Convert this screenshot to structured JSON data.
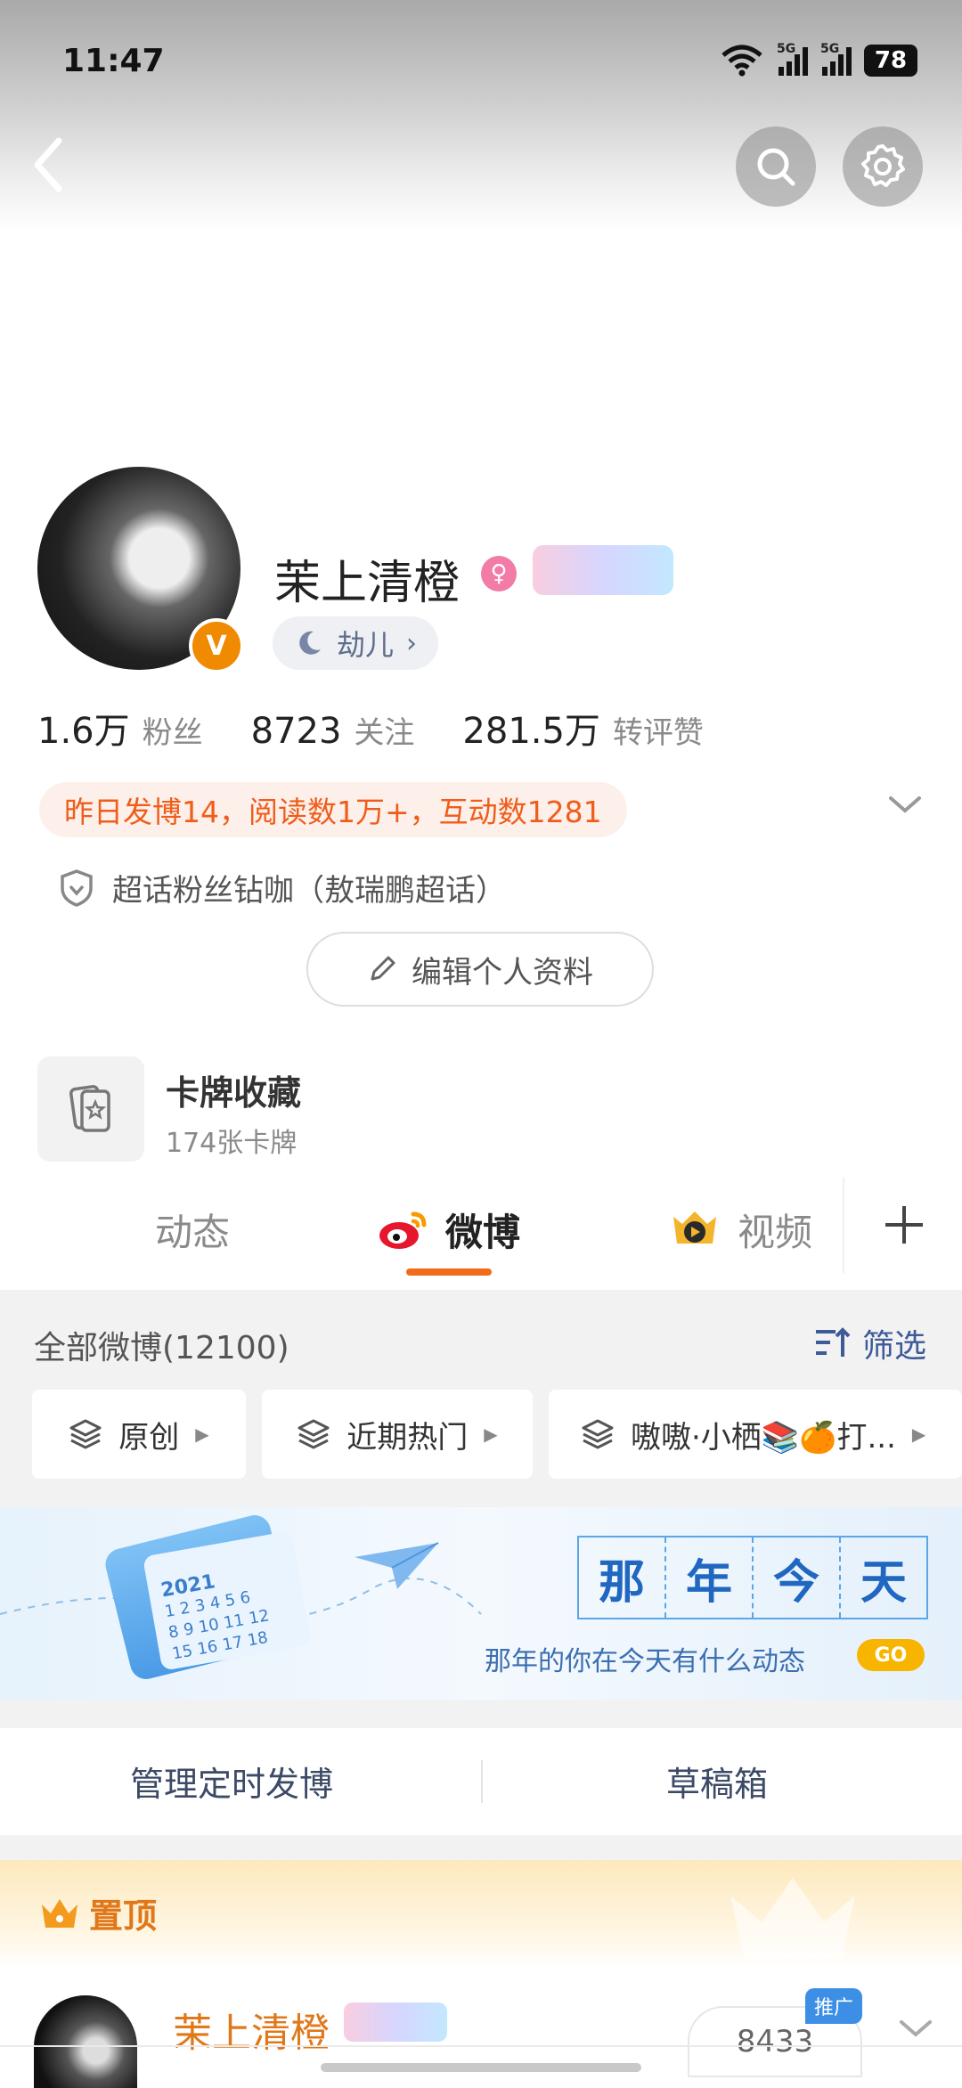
{
  "status_bar": {
    "time": "11:47",
    "battery": "78",
    "signal_1": "5G",
    "signal_2": "5G"
  },
  "header": {
    "back_icon": "chevron-left-icon",
    "search_icon": "search-icon",
    "settings_icon": "gear-icon"
  },
  "profile": {
    "username": "茉上清橙",
    "verified_badge": "V",
    "level_label": "劫儿",
    "stats": [
      {
        "value": "1.6万",
        "label": "粉丝"
      },
      {
        "value": "8723",
        "label": "关注"
      },
      {
        "value": "281.5万",
        "label": "转评赞"
      }
    ],
    "activity": "昨日发博14，阅读数1万+，互动数1281",
    "supertopic": "超话粉丝钻咖（敖瑞鹏超话）",
    "edit_button": "编辑个人资料",
    "accent_color": "#f26a1b"
  },
  "cards": {
    "title": "卡牌收藏",
    "subtitle": "174张卡牌"
  },
  "tabs": [
    {
      "label": "动态"
    },
    {
      "label": "微博"
    },
    {
      "label": "视频"
    }
  ],
  "feed_header": {
    "all_posts": "全部微博(12100)",
    "filter": "筛选"
  },
  "chips": [
    {
      "label": "原创"
    },
    {
      "label": "近期热门"
    },
    {
      "label": "嗷嗷·小栖📚🍊打..."
    }
  ],
  "banner": {
    "title_chars": [
      "那",
      "年",
      "今",
      "天"
    ],
    "subtitle": "那年的你在今天有什么动态",
    "go": "GO",
    "calendar_year": "2021"
  },
  "manage": {
    "scheduled": "管理定时发博",
    "drafts": "草稿箱"
  },
  "pinned": {
    "label": "置顶",
    "post_author": "茉上清橙",
    "count": "8433",
    "promo": "推广"
  }
}
